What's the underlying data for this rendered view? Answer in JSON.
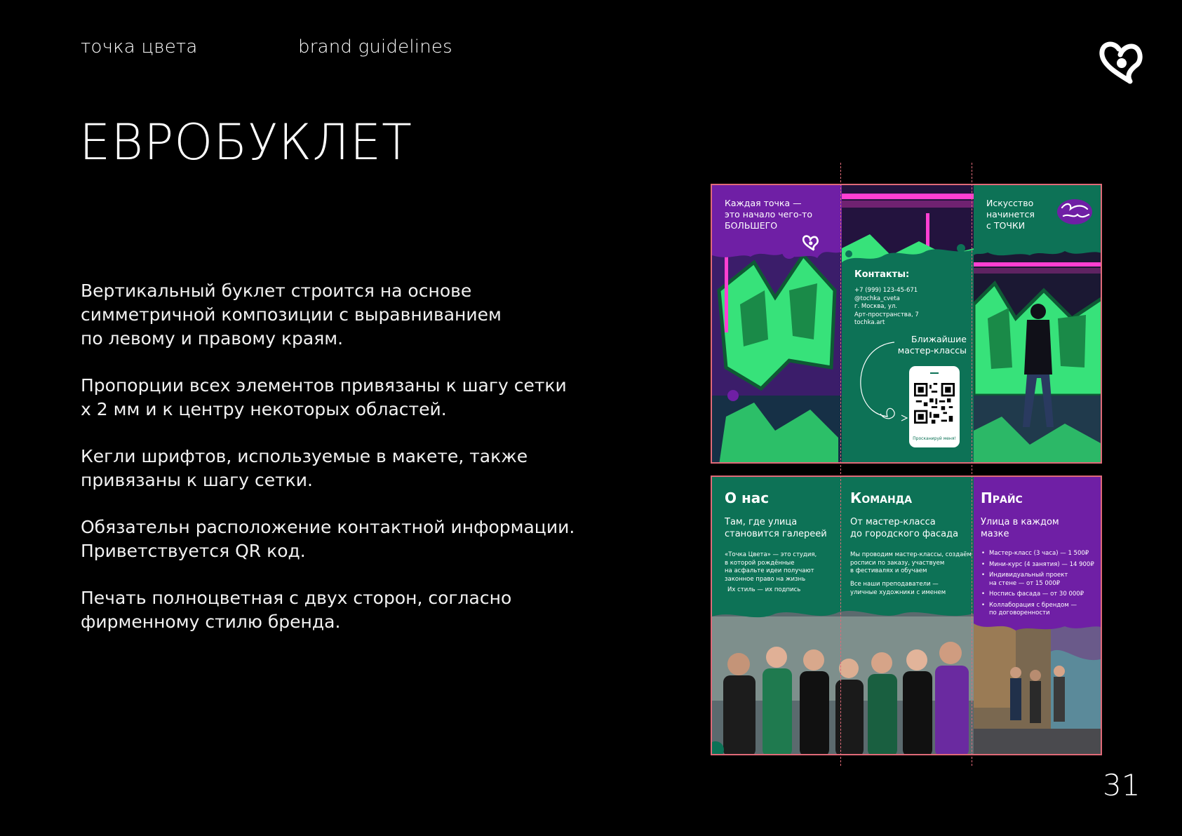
{
  "header": {
    "brand_name": "точка цвета",
    "section": "brand guidelines",
    "logo_icon": "heart-dot-logo-icon"
  },
  "title": "ЕВРОБУКЛЕТ",
  "paragraphs": [
    "Вертикальный буклет строится на основе\nсимметричной композиции с выравниванием\nпо левому и правому краям.",
    "Пропорции всех элементов привязаны к шагу сетки\nх 2 мм и к центру некоторых областей.",
    "Кегли шрифтов, используемые в макете, также\nпривязаны к шагу сетки.",
    "Обязательн расположение контактной информации.\nПриветствуется QR код.",
    "Печать полноцветная с двух сторон, согласно\nфирменному стилю бренда."
  ],
  "page_number": "31",
  "colors": {
    "background": "#000000",
    "brand_purple": "#6f1fa5",
    "brand_green": "#0d7256",
    "guide_line": "#e06a78",
    "neon_pink": "#ff3fd2",
    "graffiti_green": "#37e27a"
  },
  "booklet": {
    "outside": {
      "panel1": {
        "slogan": "Каждая точка —\nэто начало чего-то\nБОЛЬШЕГО"
      },
      "panel2": {
        "contacts_title": "Контакты:",
        "contacts": "+7 (999) 123-45-671\n@tochka_cveta\nг. Москва, ул.\nАрт-пространства, 7\ntochka.art",
        "masterclass_note": "Ближайшие\nмастер-классы",
        "qr_caption": "Просканируй меня!"
      },
      "panel3": {
        "slogan": "Искусство\nначинется\nс ТОЧКИ",
        "logo_lettering": "Точка Цвета"
      }
    },
    "inside": {
      "about": {
        "heading": "О нас",
        "subheading": "Там, где улица\nстановится галереей",
        "text": "«Точка Цвета» — это студия,\nв которой рождённые\nна асфальте идеи получают\nзаконное право на жизнь",
        "tagline": "Их стиль — их подпись"
      },
      "team": {
        "heading": "Команда",
        "subheading": "От мастер-класса\nдо городского фасада",
        "text": "Мы проводим мастер-классы, создаём\nросписи по заказу, участвуем\nв фестивалях и обучаем",
        "text2": "Все наши преподаватели —\nуличные художники с именем"
      },
      "price": {
        "heading": "Прайс",
        "subheading": "Улица в каждом\nмазке",
        "items": [
          "Мастер-класс (3 часа) — 1 500₽",
          "Мини-курс (4 занятия) — 14 900₽",
          "Индивидуальный проект\nна стене — от 15 000₽",
          "Носпись фасада — от 30 000₽",
          "Коллаборация с брендом —\nпо договоренности"
        ]
      }
    }
  }
}
